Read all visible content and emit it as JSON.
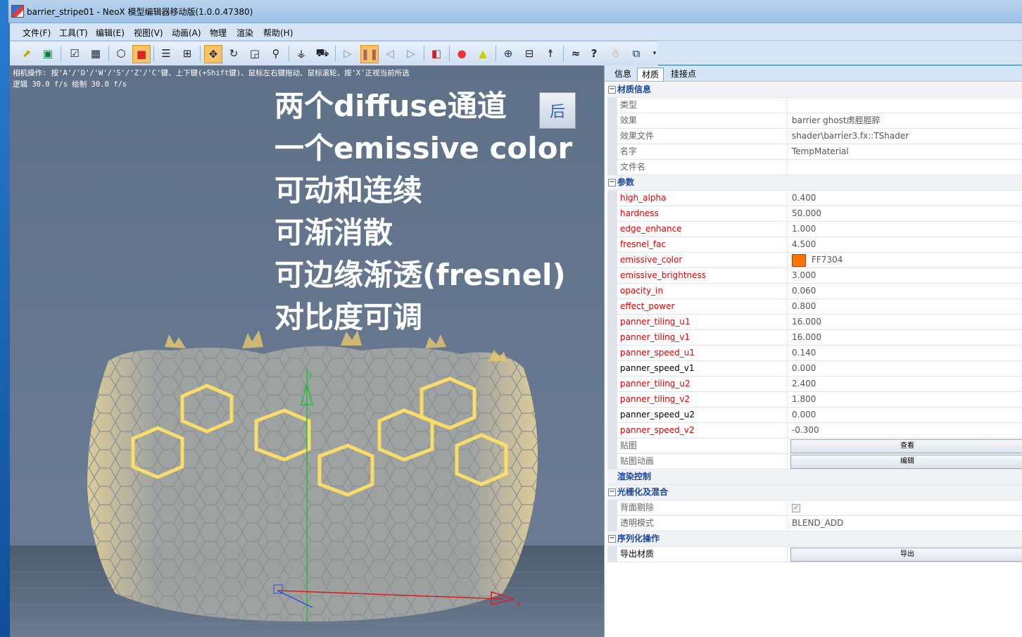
{
  "window": {
    "title": "barrier_stripe01 - NeoX 模型编辑器移动版(1.0.0.47380)"
  },
  "menu": [
    "文件(F)",
    "工具(T)",
    "编辑(E)",
    "视图(V)",
    "动画(A)",
    "物理",
    "渲染",
    "帮助(H)"
  ],
  "viewport": {
    "camera_hint": "相机操作: 按'A'/'D'/'W'/'S'/'Z'/'C'键、上下键(+Shift键)、鼠标左右键拖动、鼠标滚轮，按'X'正视当前所选",
    "fps_line": "逻辑 30.0 f/s  绘制 30.0 f/s",
    "overlay_lines": [
      "两个diffuse通道",
      "一个emissive color",
      "可动和连续",
      "可渐消散",
      "可边缘渐透(fresnel)",
      "对比度可调"
    ],
    "view_cube_label": "后",
    "gizmo_y_label": "y",
    "gizmo_x_label": "x"
  },
  "sidebar": {
    "tabs": [
      "信息",
      "材质",
      "挂接点"
    ],
    "selected_tab": "材质",
    "sections": {
      "material_info": {
        "title": "材质信息",
        "rows": [
          {
            "label": "类型",
            "value": ""
          },
          {
            "label": "效果",
            "value": "barrier    ghost虏脛脛脺"
          },
          {
            "label": "效果文件",
            "value": "shader\\barrier3.fx::TShader"
          },
          {
            "label": "名字",
            "value": "TempMaterial"
          },
          {
            "label": "文件名",
            "value": ""
          }
        ]
      },
      "params": {
        "title": "参数",
        "rows": [
          {
            "label": "high_alpha",
            "value": "0.400"
          },
          {
            "label": "hardness",
            "value": "50.000"
          },
          {
            "label": "edge_enhance",
            "value": "1.000"
          },
          {
            "label": "fresnel_fac",
            "value": "4.500"
          },
          {
            "label": "emissive_color",
            "value": "FF7304",
            "swatch": "#FF7304"
          },
          {
            "label": "emissive_brightness",
            "value": "3.000"
          },
          {
            "label": "opacity_in",
            "value": "0.060"
          },
          {
            "label": "effect_power",
            "value": "0.800"
          },
          {
            "label": "panner_tiling_u1",
            "value": "16.000"
          },
          {
            "label": "panner_tiling_v1",
            "value": "16.000"
          },
          {
            "label": "panner_speed_u1",
            "value": "0.140"
          },
          {
            "label": "panner_speed_v1",
            "value": "0.000"
          },
          {
            "label": "panner_tiling_u2",
            "value": "2.400"
          },
          {
            "label": "panner_tiling_v2",
            "value": "1.800"
          },
          {
            "label": "panner_speed_u2",
            "value": "0.000"
          },
          {
            "label": "panner_speed_v2",
            "value": "-0.300"
          }
        ],
        "texture_label": "贴图",
        "texture_button": "查看",
        "texture_anim_label": "贴图动画",
        "texture_anim_button": "编辑"
      },
      "render_control": {
        "title": "渲染控制"
      },
      "raster": {
        "title": "光栅化及混合",
        "cull_label": "背面剔除",
        "cull_checked": true,
        "blend_label": "透明模式",
        "blend_value": "BLEND_ADD"
      },
      "serialize": {
        "title": "序列化操作",
        "export_label": "导出材质",
        "export_button": "导出"
      }
    }
  }
}
